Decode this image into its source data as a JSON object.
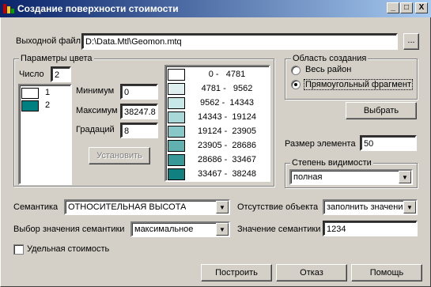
{
  "window": {
    "title": "Создание поверхности стоимости",
    "minimize": "_",
    "maximize": "□",
    "close": "X"
  },
  "output": {
    "label": "Выходной файл",
    "value": "D:\\Data.Mtl\\Geomon.mtq",
    "browse": "..."
  },
  "color_params": {
    "title": "Параметры цвета",
    "count_label": "Число",
    "count_value": "2",
    "palette": [
      {
        "index": "1",
        "color": "#ffffff"
      },
      {
        "index": "2",
        "color": "#008080"
      }
    ],
    "min_label": "Минимум",
    "min_value": "0",
    "max_label": "Максимум",
    "max_value": "38247.8",
    "grad_label": "Градаций",
    "grad_value": "8",
    "apply_button": "Установить",
    "ranges": [
      {
        "text": "0 -   4781",
        "color": "#ffffff"
      },
      {
        "text": "4781 -   9562",
        "color": "#e0f0f0"
      },
      {
        "text": "9562 -  14343",
        "color": "#c8e8e8"
      },
      {
        "text": "14343 -  19124",
        "color": "#a8d8d8"
      },
      {
        "text": "19124 -  23905",
        "color": "#88c8c8"
      },
      {
        "text": "23905 -  28686",
        "color": "#60b0b0"
      },
      {
        "text": "28686 -  33467",
        "color": "#389898"
      },
      {
        "text": "33467 -  38248",
        "color": "#108080"
      }
    ]
  },
  "area": {
    "title": "Область создания",
    "option_all": "Весь район",
    "option_rect": "Прямоугольный фрагмент",
    "select_button": "Выбрать"
  },
  "element_size": {
    "label": "Размер элемента",
    "value": "50"
  },
  "visibility": {
    "title": "Степень видимости",
    "value": "полная"
  },
  "semantics": {
    "label": "Семантика",
    "value": "ОТНОСИТЕЛЬНАЯ ВЫСОТА",
    "choice_label": "Выбор значения семантики",
    "choice_value": "максимальное",
    "missing_label": "Отсутствие объекта",
    "missing_value": "заполнить значени",
    "value_label": "Значение семантики",
    "value_value": "1234"
  },
  "specific_cost": {
    "label": "Удельная стоимость"
  },
  "footer": {
    "build": "Построить",
    "cancel": "Отказ",
    "help": "Помощь"
  }
}
